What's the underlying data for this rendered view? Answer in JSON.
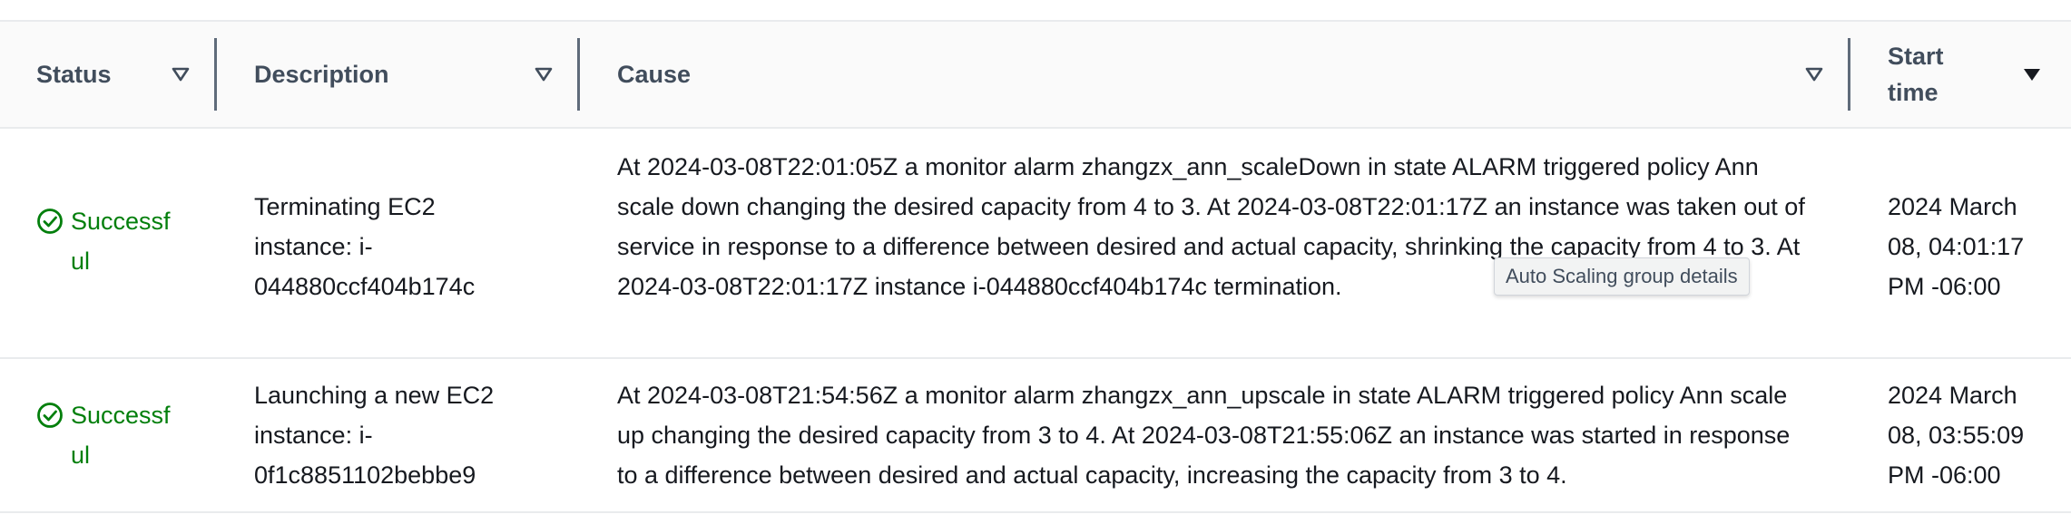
{
  "table": {
    "columns": [
      {
        "label": "Status"
      },
      {
        "label": "Description"
      },
      {
        "label": "Cause"
      },
      {
        "label": "Start time"
      }
    ],
    "rows": [
      {
        "status": "Successful",
        "description": "Terminating EC2 instance: i-044880ccf404b174c",
        "cause": "At 2024-03-08T22:01:05Z a monitor alarm zhangzx_ann_scaleDown in state ALARM triggered policy Ann scale down changing the desired capacity from 4 to 3. At 2024-03-08T22:01:17Z an instance was taken out of service in response to a difference between desired and actual capacity, shrinking the capacity from 4 to 3. At 2024-03-08T22:01:17Z instance i-044880ccf404b174c",
        "cause_tail": "termination.",
        "start_time": "2024 March 08, 04:01:17 PM -06:00"
      },
      {
        "status": "Successful",
        "description": "Launching a new EC2 instance: i-0f1c8851102bebbe9",
        "cause": "At 2024-03-08T21:54:56Z a monitor alarm zhangzx_ann_upscale in state ALARM triggered policy Ann scale up changing the desired capacity from 3 to 4. At 2024-03-08T21:55:06Z an instance was started in response to a difference between desired and actual capacity, increasing the capacity from 3 to 4.",
        "start_time": "2024 March 08, 03:55:09 PM -06:00"
      }
    ]
  },
  "tooltip": "Auto Scaling group details",
  "colors": {
    "success": "#037f0c",
    "header_text": "#414d5c",
    "body_text": "#16191f"
  },
  "icons": {
    "sort_inactive": "caret-down-outline-icon",
    "sort_active": "caret-down-filled-icon",
    "status_success": "check-circle-icon"
  }
}
